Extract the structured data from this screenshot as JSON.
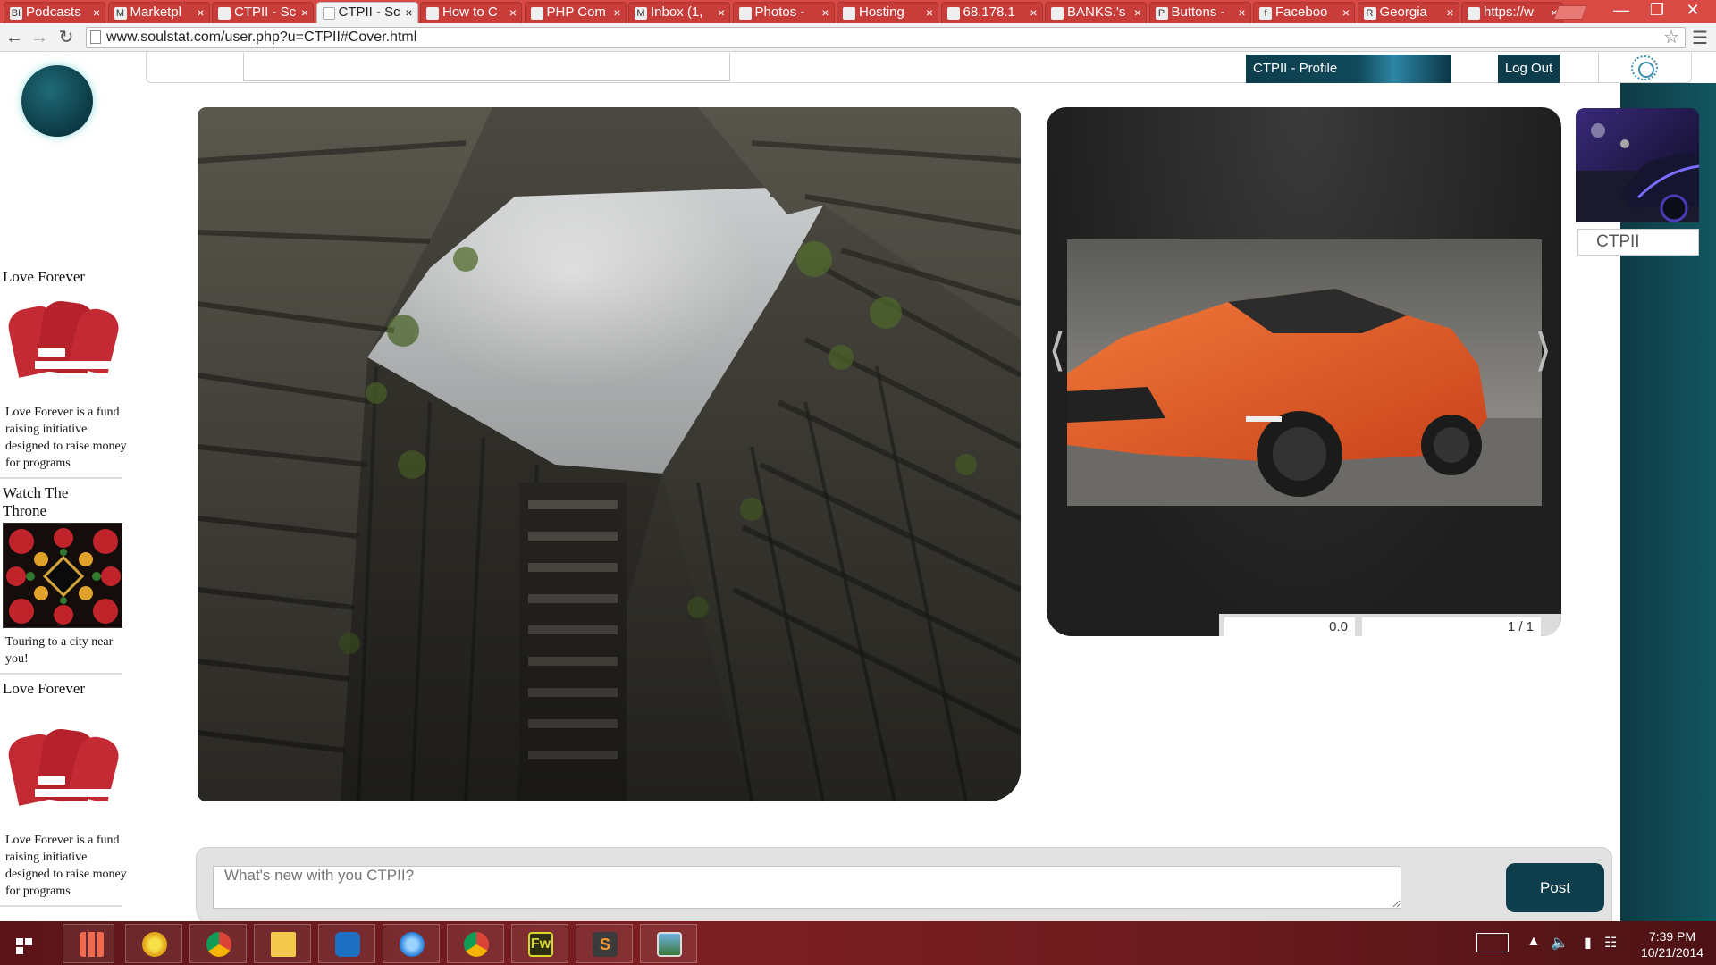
{
  "browser": {
    "tabs": [
      {
        "title": "Podcasts",
        "favicon": "BI",
        "active": false
      },
      {
        "title": "Marketpl",
        "favicon": "M",
        "active": false
      },
      {
        "title": "CTPII - Sc",
        "favicon": "",
        "active": false
      },
      {
        "title": "CTPII - Sc",
        "favicon": "",
        "active": true
      },
      {
        "title": "How to C",
        "favicon": "",
        "active": false
      },
      {
        "title": "PHP Com",
        "favicon": "",
        "active": false
      },
      {
        "title": "Inbox (1,",
        "favicon": "M",
        "active": false
      },
      {
        "title": "Photos -",
        "favicon": "",
        "active": false
      },
      {
        "title": "Hosting",
        "favicon": "",
        "active": false
      },
      {
        "title": "68.178.1",
        "favicon": "",
        "active": false
      },
      {
        "title": "BANKS.'s",
        "favicon": "",
        "active": false
      },
      {
        "title": "Buttons -",
        "favicon": "P",
        "active": false
      },
      {
        "title": "Faceboo",
        "favicon": "f",
        "active": false
      },
      {
        "title": "Georgia",
        "favicon": "R",
        "active": false
      },
      {
        "title": "https://w",
        "favicon": "",
        "active": false
      }
    ],
    "url": "www.soulstat.com/user.php?u=CTPII#Cover.html"
  },
  "nav": {
    "profile_label": "CTPII - Profile",
    "logout_label": "Log Out"
  },
  "ads": {
    "ad1_title": "Love Forever",
    "ad1_desc": "Love Forever is a fund raising initiative designed to raise money for programs",
    "ad2_title": "Watch The Throne",
    "ad2_desc": "Touring to a city near you!",
    "ad3_title": "Love Forever",
    "ad3_desc": "Love Forever is a fund raising initiative designed to raise money for programs"
  },
  "slider": {
    "rating": "0.0",
    "counter": "1 / 1",
    "prev_glyph": "⟨",
    "next_glyph": "⟩"
  },
  "profile": {
    "name": "CTPII"
  },
  "post": {
    "placeholder": "What's new with you CTPII?",
    "button_label": "Post"
  },
  "taskbar": {
    "time": "7:39 PM",
    "date": "10/21/2014",
    "apps": [
      "start-screen-icon",
      "apps-grid-icon",
      "chrome-canary-icon",
      "chrome-icon",
      "file-explorer-icon",
      "teamviewer-icon",
      "quicktime-icon",
      "chrome-icon",
      "fireworks-icon",
      "sublime-text-icon",
      "photo-viewer-icon"
    ],
    "fireworks_label": "Fw",
    "sublime_label": "S"
  },
  "colors": {
    "accent": "#0e3d4b",
    "tab_bar": "#d94a45",
    "taskbar": "#7d1f22"
  }
}
